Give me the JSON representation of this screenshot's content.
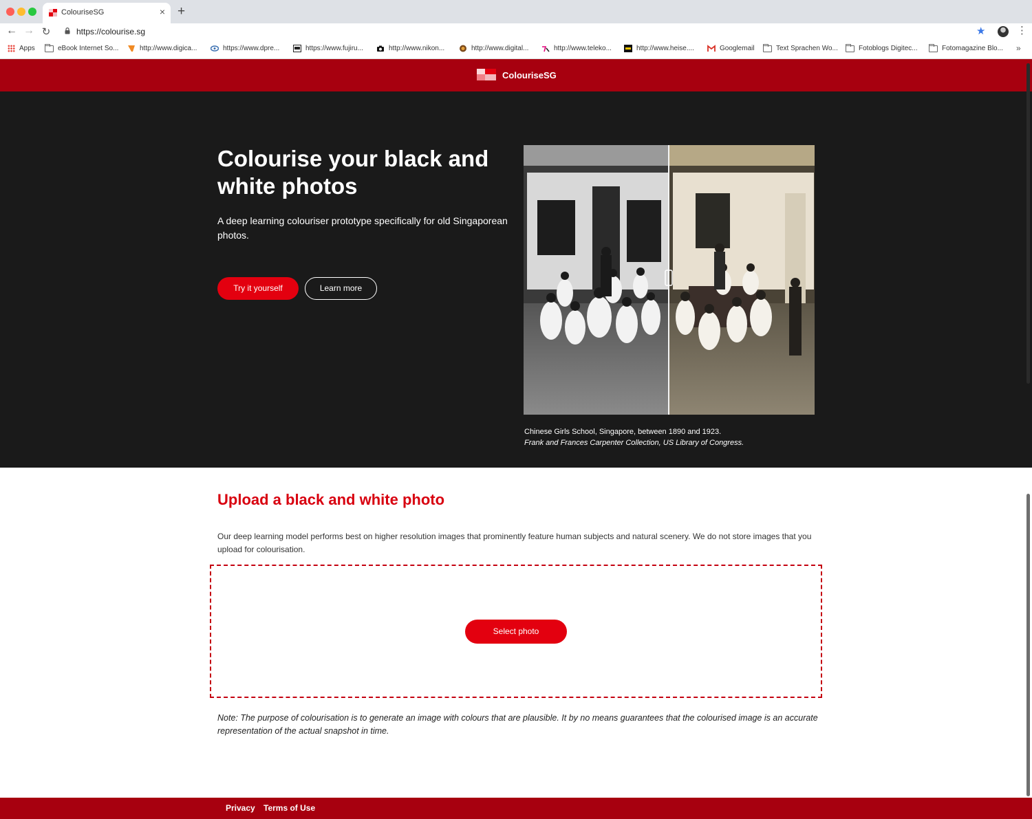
{
  "browser": {
    "tab_title": "ColouriseSG",
    "tab_close": "×",
    "new_tab": "+",
    "url": "https://colourise.sg",
    "nav": {
      "back": "←",
      "forward": "→",
      "reload": "↻"
    },
    "star": "★",
    "menu": "⋮",
    "bookmarks": [
      {
        "label": "Apps",
        "icon": "apps-icon"
      },
      {
        "label": "eBook Internet So...",
        "icon": "folder-icon"
      },
      {
        "label": "http://www.digica...",
        "icon": "site-icon"
      },
      {
        "label": "https://www.dpre...",
        "icon": "site-icon"
      },
      {
        "label": "https://www.fujiru...",
        "icon": "site-icon"
      },
      {
        "label": "http://www.nikon...",
        "icon": "camera-icon"
      },
      {
        "label": "http://www.digital...",
        "icon": "site-icon"
      },
      {
        "label": "http://www.teleko...",
        "icon": "site-icon"
      },
      {
        "label": "http://www.heise....",
        "icon": "site-icon"
      },
      {
        "label": "Googlemail",
        "icon": "gmail-icon"
      },
      {
        "label": "Text Sprachen Wo...",
        "icon": "folder-icon"
      },
      {
        "label": "Fotoblogs Digitec...",
        "icon": "folder-icon"
      },
      {
        "label": "Fotomagazine Blo...",
        "icon": "folder-icon"
      }
    ],
    "bookmarks_more": "»"
  },
  "header": {
    "logo_text": "ColouriseSG"
  },
  "hero": {
    "title": "Colourise your black and white photos",
    "subtitle": "A deep learning colouriser prototype specifically for old Singaporean photos.",
    "try_button": "Try it yourself",
    "learn_button": "Learn more",
    "caption_line1": "Chinese Girls School, Singapore, between 1890 and 1923.",
    "caption_line2": "Frank and Frances Carpenter Collection, US Library of Congress.",
    "compare_split": 0.5
  },
  "upload": {
    "title": "Upload a black and white photo",
    "description": "Our deep learning model performs best on higher resolution images that prominently feature human subjects and natural scenery. We do not store images that you upload for colourisation.",
    "select_button": "Select photo",
    "note": "Note: The purpose of colourisation is to generate an image with colours that are plausible. It by no means guarantees that the colourised image is an accurate representation of the actual snapshot in time."
  },
  "footer": {
    "privacy": "Privacy",
    "terms": "Terms of Use"
  },
  "colors": {
    "brand_red": "#a7000f",
    "button_red": "#e3000f",
    "hero_bg": "#1a1a1a",
    "upload_title": "#d8000f"
  }
}
